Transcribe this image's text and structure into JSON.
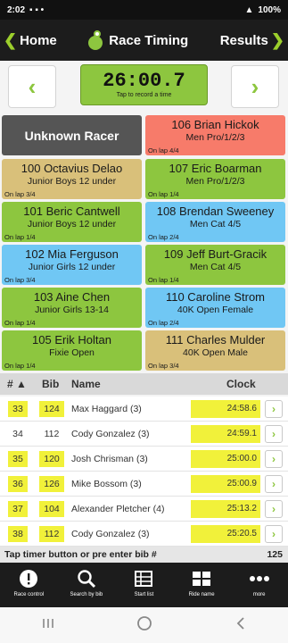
{
  "status_bar": {
    "time": "2:02",
    "battery": "100%"
  },
  "nav": {
    "back_label": "Home",
    "title": "Race Timing",
    "forward_label": "Results"
  },
  "timer": {
    "value": "26:00.7",
    "hint": "Tap to record a time"
  },
  "racers": [
    {
      "name": "Unknown Racer",
      "category": "",
      "lap": "",
      "color": "#555555"
    },
    {
      "name": "106 Brian Hickok",
      "category": "Men Pro/1/2/3",
      "lap": "On lap 4/4",
      "color": "#f77b6a"
    },
    {
      "name": "100 Octavius Delao",
      "category": "Junior Boys 12 under",
      "lap": "On lap 3/4",
      "color": "#d9c07a"
    },
    {
      "name": "107 Eric Boarman",
      "category": "Men Pro/1/2/3",
      "lap": "On lap 1/4",
      "color": "#8dc63f"
    },
    {
      "name": "101 Beric Cantwell",
      "category": "Junior Boys 12 under",
      "lap": "On lap 1/4",
      "color": "#8dc63f"
    },
    {
      "name": "108 Brendan Sweeney",
      "category": "Men Cat 4/5",
      "lap": "On lap 2/4",
      "color": "#70c7f4"
    },
    {
      "name": "102 Mia Ferguson",
      "category": "Junior Girls 12 under",
      "lap": "On lap 3/4",
      "color": "#70c7f4"
    },
    {
      "name": "109 Jeff Burt-Gracik",
      "category": "Men Cat 4/5",
      "lap": "On lap 1/4",
      "color": "#8dc63f"
    },
    {
      "name": "103 Aine Chen",
      "category": "Junior Girls 13-14",
      "lap": "On lap 1/4",
      "color": "#8dc63f"
    },
    {
      "name": "110 Caroline Strom",
      "category": "40K Open Female",
      "lap": "On lap 2/4",
      "color": "#70c7f4"
    },
    {
      "name": "105 Erik Holtan",
      "category": "Fixie Open",
      "lap": "On lap 1/4",
      "color": "#8dc63f"
    },
    {
      "name": "111 Charles Mulder",
      "category": "40K Open Male",
      "lap": "On lap 3/4",
      "color": "#d9c07a"
    }
  ],
  "results": {
    "headers": {
      "num": "# ▲",
      "bib": "Bib",
      "name": "Name",
      "clock": "Clock"
    },
    "rows": [
      {
        "num": "33",
        "bib": "124",
        "name": "Max Haggard (3)",
        "clock": "24:58.6",
        "highlight": true
      },
      {
        "num": "34",
        "bib": "112",
        "name": "Cody Gonzalez (3)",
        "clock": "24:59.1",
        "highlight": false
      },
      {
        "num": "35",
        "bib": "120",
        "name": "Josh Chrisman (3)",
        "clock": "25:00.0",
        "highlight": true
      },
      {
        "num": "36",
        "bib": "126",
        "name": "Mike Bossom (3)",
        "clock": "25:00.9",
        "highlight": true
      },
      {
        "num": "37",
        "bib": "104",
        "name": "Alexander Pletcher (4)",
        "clock": "25:13.2",
        "highlight": true
      },
      {
        "num": "38",
        "bib": "112",
        "name": "Cody Gonzalez (3)",
        "clock": "25:20.5",
        "highlight": true
      }
    ]
  },
  "bib_bar": {
    "hint": "Tap timer button or pre enter bib #",
    "entry": "125"
  },
  "tabs": [
    {
      "label": "Race control",
      "icon": "alert-icon"
    },
    {
      "label": "Search by bib",
      "icon": "search-icon"
    },
    {
      "label": "Start list",
      "icon": "list-icon"
    },
    {
      "label": "Ride name",
      "icon": "grid-icon"
    },
    {
      "label": "more",
      "icon": "more-icon"
    }
  ],
  "colors": {
    "accent": "#8dc63f",
    "highlight": "#f1f13a",
    "navbar": "#1c1c1c"
  }
}
